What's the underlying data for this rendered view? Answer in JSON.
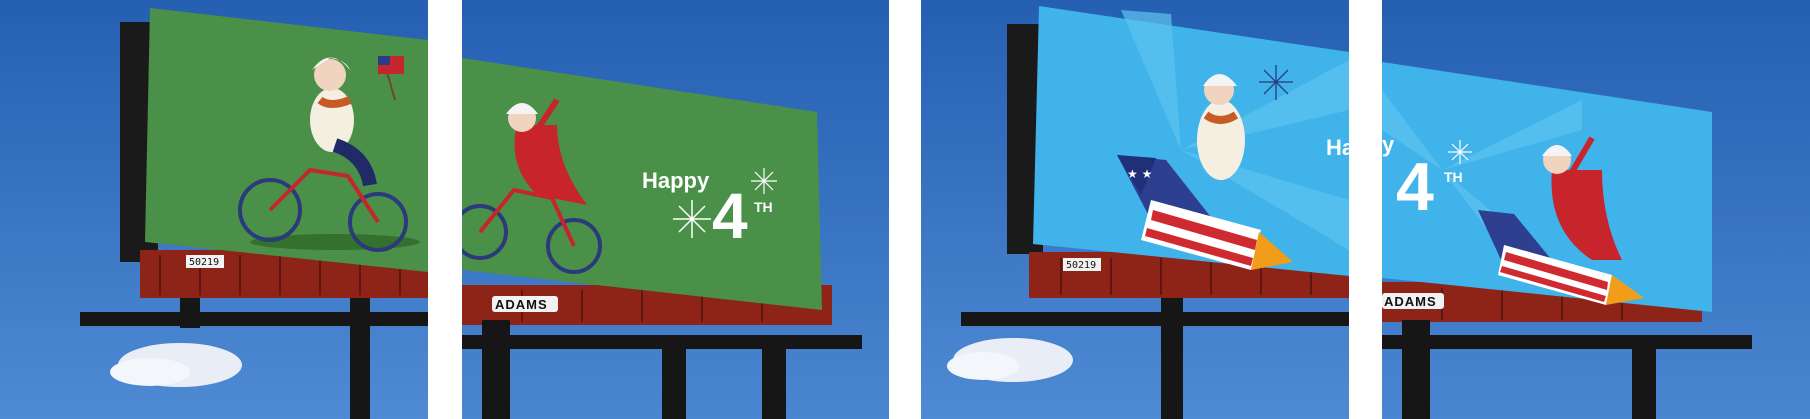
{
  "scenes": [
    {
      "id": 1,
      "board_color": "#4a9048",
      "theme": "cyclist"
    },
    {
      "id": 2,
      "board_color": "#4a9048",
      "theme": "cyclist-happy-4th",
      "greeting": "Happy",
      "number": "4",
      "suffix": "TH",
      "brand": "ADAMS"
    },
    {
      "id": 3,
      "board_color": "#3fb3ea",
      "theme": "rocket-rider",
      "greeting_partial": "Ha"
    },
    {
      "id": 4,
      "board_color": "#3fb3ea",
      "theme": "rocket-rider",
      "greeting_partial": "y",
      "number": "4",
      "suffix": "TH",
      "brand": "ADAMS"
    }
  ],
  "panel_ids": {
    "p1": "50219",
    "p3": "50219"
  },
  "colors": {
    "sky_top": "#2b64b5",
    "sky_bottom": "#5a92d6",
    "green_board": "#4a9048",
    "blue_board": "#3fb3ea",
    "catwalk_red": "#8e2418",
    "structure": "#141414"
  }
}
